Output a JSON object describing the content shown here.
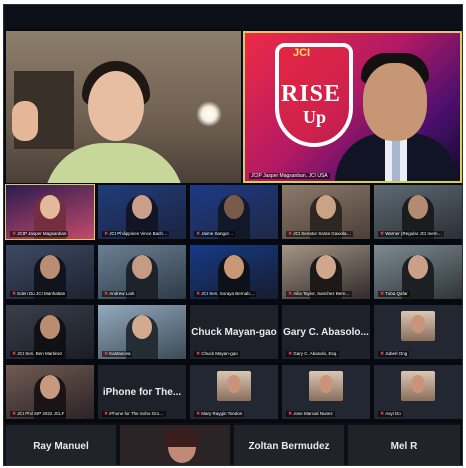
{
  "speakers": [
    {
      "caption": ""
    },
    {
      "caption": "JCIP Jasper Magsanban, JCI USA",
      "poster_brand": "JCI",
      "poster_title": "RISE",
      "poster_subtitle": "Up"
    }
  ],
  "grid": [
    {
      "caption": "JCIP Jasper Magsanban",
      "type": "video"
    },
    {
      "caption": "JCI Philippines Vince Bach…",
      "type": "video"
    },
    {
      "caption": "Jaime Sangor…",
      "type": "video"
    },
    {
      "caption": "JCI Senator Santa Gaxiola…",
      "type": "video"
    },
    {
      "caption": "Warner (Regular JCI mem…",
      "type": "video"
    },
    {
      "caption": "Eden Du JCI Manhattan",
      "type": "video"
    },
    {
      "caption": "Andrew Lark",
      "type": "video"
    },
    {
      "caption": "JCI Sen. Soraya Bernab…",
      "type": "video"
    },
    {
      "caption": "Ailia Taylor, Sanchez Bern…",
      "type": "video"
    },
    {
      "caption": "Tuba Qafar",
      "type": "video"
    },
    {
      "caption": "JCI Sen. Ben Martinez",
      "type": "video"
    },
    {
      "caption": "Kastanova",
      "type": "video"
    },
    {
      "caption": "Chuck Mayan-gao",
      "big": "Chuck Mayan-gao",
      "type": "name"
    },
    {
      "caption": "Gary C. Abasolo, Esq.",
      "big": "Gary C. Abasolo...",
      "type": "name"
    },
    {
      "caption": "Juberl Ong",
      "type": "thumb"
    },
    {
      "caption": "JCI Phil SIP 2022 JCLF",
      "type": "video"
    },
    {
      "caption": "iPhone for The Soho Gro…",
      "big": "iPhone for The...",
      "type": "name"
    },
    {
      "caption": "Mary Raygin Tondon",
      "type": "thumb"
    },
    {
      "caption": "Jose Marcial Nunez",
      "type": "thumb"
    },
    {
      "caption": "Asyi Do",
      "type": "thumb"
    }
  ],
  "bottom_row": [
    {
      "label": "Ray Manuel"
    },
    {
      "label": ""
    },
    {
      "label": "Zoltan Bermudez"
    },
    {
      "label": "Mel R"
    }
  ],
  "colors": {
    "active_speaker_border": "#d8cf5a",
    "muted_icon": "#e03b3b",
    "tile_bg": "#232731"
  },
  "icons": {
    "muted": "mic-muted-icon"
  }
}
